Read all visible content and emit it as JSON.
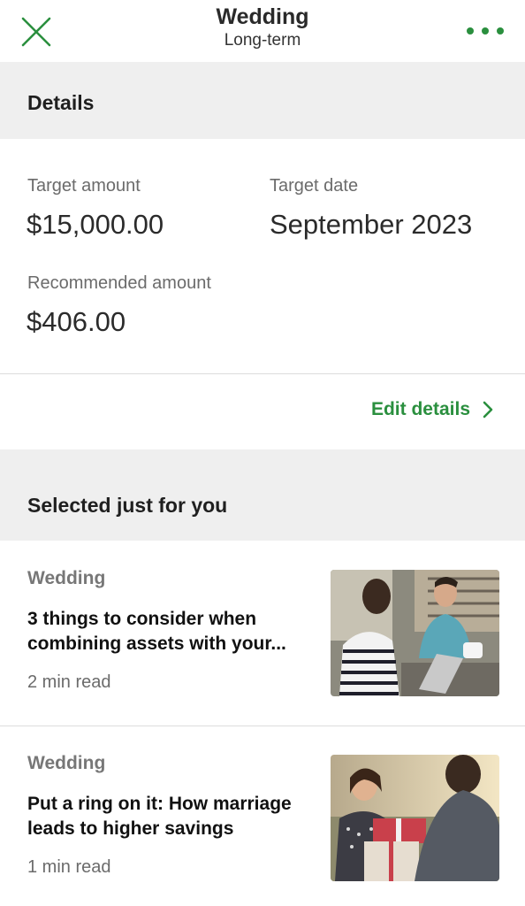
{
  "header": {
    "title": "Wedding",
    "subtitle": "Long-term"
  },
  "details": {
    "section_title": "Details",
    "target_amount_label": "Target amount",
    "target_amount_value": "$15,000.00",
    "target_date_label": "Target date",
    "target_date_value": "September 2023",
    "recommended_label": "Recommended amount",
    "recommended_value": "$406.00",
    "edit_label": "Edit details"
  },
  "articles_section": {
    "title": "Selected just for you",
    "items": [
      {
        "category": "Wedding",
        "title": "3 things to consider when combining assets with your...",
        "meta": "2 min read"
      },
      {
        "category": "Wedding",
        "title": "Put a ring on it: How marriage leads to higher savings",
        "meta": "1 min read"
      }
    ]
  },
  "colors": {
    "accent": "#2a8f3e",
    "band": "#efefef"
  },
  "icons": [
    "close-icon",
    "more-icon",
    "chevron-right-icon"
  ]
}
